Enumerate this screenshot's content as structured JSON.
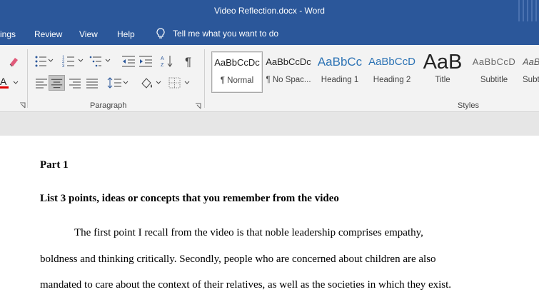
{
  "window": {
    "title": "Video Reflection.docx  -  Word"
  },
  "tabs": [
    "ings",
    "Review",
    "View",
    "Help"
  ],
  "tell_me": {
    "placeholder": "Tell me what you want to do"
  },
  "ribbon": {
    "paragraph_label": "Paragraph",
    "styles_label": "Styles",
    "styles": [
      {
        "sample": "AaBbCcDc",
        "name": "¶ Normal",
        "selected": true
      },
      {
        "sample": "AaBbCcDc",
        "name": "¶ No Spac..."
      },
      {
        "sample": "AaBbCc",
        "name": "Heading 1"
      },
      {
        "sample": "AaBbCcD",
        "name": "Heading 2"
      },
      {
        "sample": "AaB",
        "name": "Title"
      },
      {
        "sample": "AaBbCcD",
        "name": "Subtitle"
      },
      {
        "sample": "AaBbC",
        "name": "Subt"
      }
    ]
  },
  "document": {
    "heading": "Part 1",
    "subheading": "List 3 points, ideas or concepts that you remember from the video",
    "paragraph_lines": [
      "The first point I recall from the video is that noble leadership comprises empathy,",
      "boldness and thinking critically. Secondly, people who are concerned about children are also",
      "mandated to care about the context of their relatives, as well as the societies in which they exist."
    ]
  },
  "colors": {
    "title_bar": "#2b579a",
    "ribbon": "#f3f3f3",
    "page": "#ffffff",
    "font_color_red": "#e00000"
  }
}
